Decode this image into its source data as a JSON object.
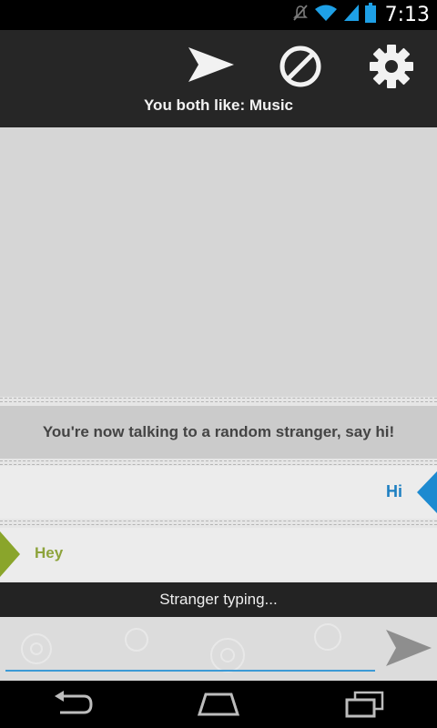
{
  "status_bar": {
    "time": "7:13",
    "icons": [
      "mute-vibrate-icon",
      "wifi-icon",
      "cell-signal-icon",
      "battery-icon"
    ]
  },
  "action_bar": {
    "icons": [
      "send-icon",
      "block-icon",
      "gear-icon"
    ],
    "common_interest": "You both like: Music"
  },
  "chat": {
    "system_message": "You're now talking to a random stranger, say hi!",
    "messages": [
      {
        "sender": "you",
        "text": "Hi"
      },
      {
        "sender": "stranger",
        "text": "Hey"
      }
    ],
    "typing_status": "Stranger typing..."
  },
  "input": {
    "value": "",
    "placeholder": "",
    "send_icon": "send-icon"
  },
  "nav_bar": {
    "icons": [
      "back-icon",
      "home-icon",
      "recent-apps-icon"
    ]
  },
  "colors": {
    "action_bar_bg": "#262626",
    "you_accent": "#1d8ad0",
    "stranger_accent": "#8aa52b",
    "input_underline": "#3c9ad6"
  }
}
